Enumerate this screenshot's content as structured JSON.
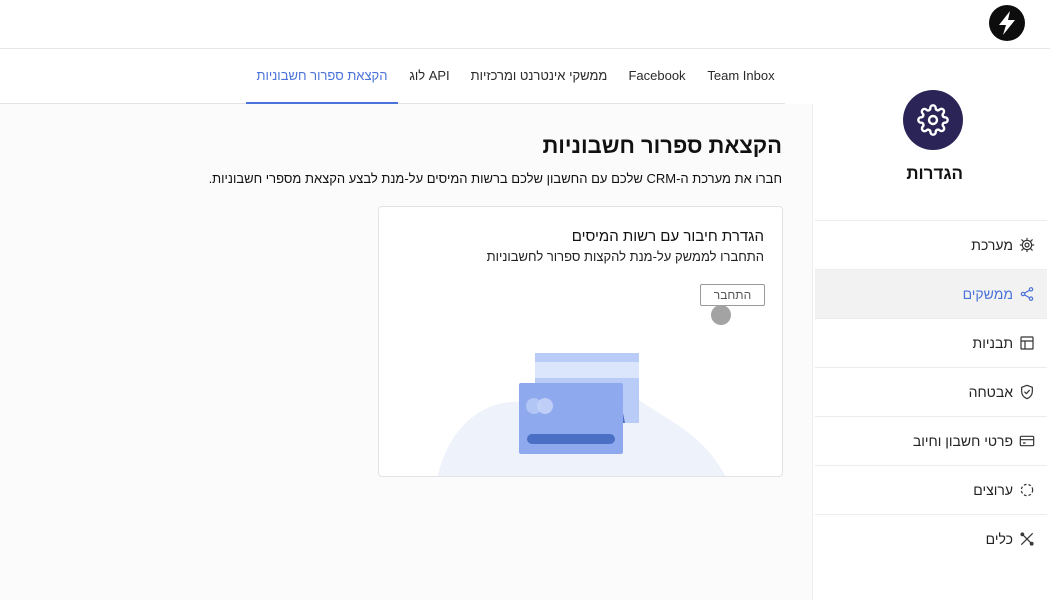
{
  "header": {
    "logo_icon": "bolt-logo-icon"
  },
  "tabs": [
    {
      "label": "Team Inbox"
    },
    {
      "label": "Facebook"
    },
    {
      "label": "ממשקי אינטרנט ומרכזיות"
    },
    {
      "label": "לוג API"
    },
    {
      "label": "הקצאת ספרור חשבוניות",
      "active": true
    }
  ],
  "sidebar": {
    "title": "הגדרות",
    "avatar_icon": "gear-icon",
    "items": [
      {
        "label": "מערכת",
        "icon": "gear-icon"
      },
      {
        "label": "ממשקים",
        "icon": "share-icon",
        "active": true
      },
      {
        "label": "תבניות",
        "icon": "layout-icon"
      },
      {
        "label": "אבטחה",
        "icon": "shield-icon"
      },
      {
        "label": "פרטי חשבון וחיוב",
        "icon": "credit-card-icon"
      },
      {
        "label": "ערוצים",
        "icon": "channels-icon"
      },
      {
        "label": "כלים",
        "icon": "tools-icon"
      }
    ]
  },
  "main": {
    "title": "הקצאת ספרור חשבוניות",
    "description": "חברו את מערכת ה-CRM שלכם עם החשבון שלכם ברשות המיסים על-מנת לבצע הקצאת מספרי חשבוניות.",
    "card": {
      "title": "הגדרת חיבור עם רשות המיסים",
      "subtitle": "התחברו לממשק על-מנת להקצות ספרור לחשבוניות",
      "connect_label": "התחבר",
      "illustration_icon": "credit-cards-illustration"
    }
  },
  "colors": {
    "accent": "#4a72d9",
    "avatar_bg": "#2a2556",
    "card_blue": "#8fa9ef",
    "card_blue_light": "#b9ccf8",
    "card_stripe": "#4a6fc4"
  }
}
